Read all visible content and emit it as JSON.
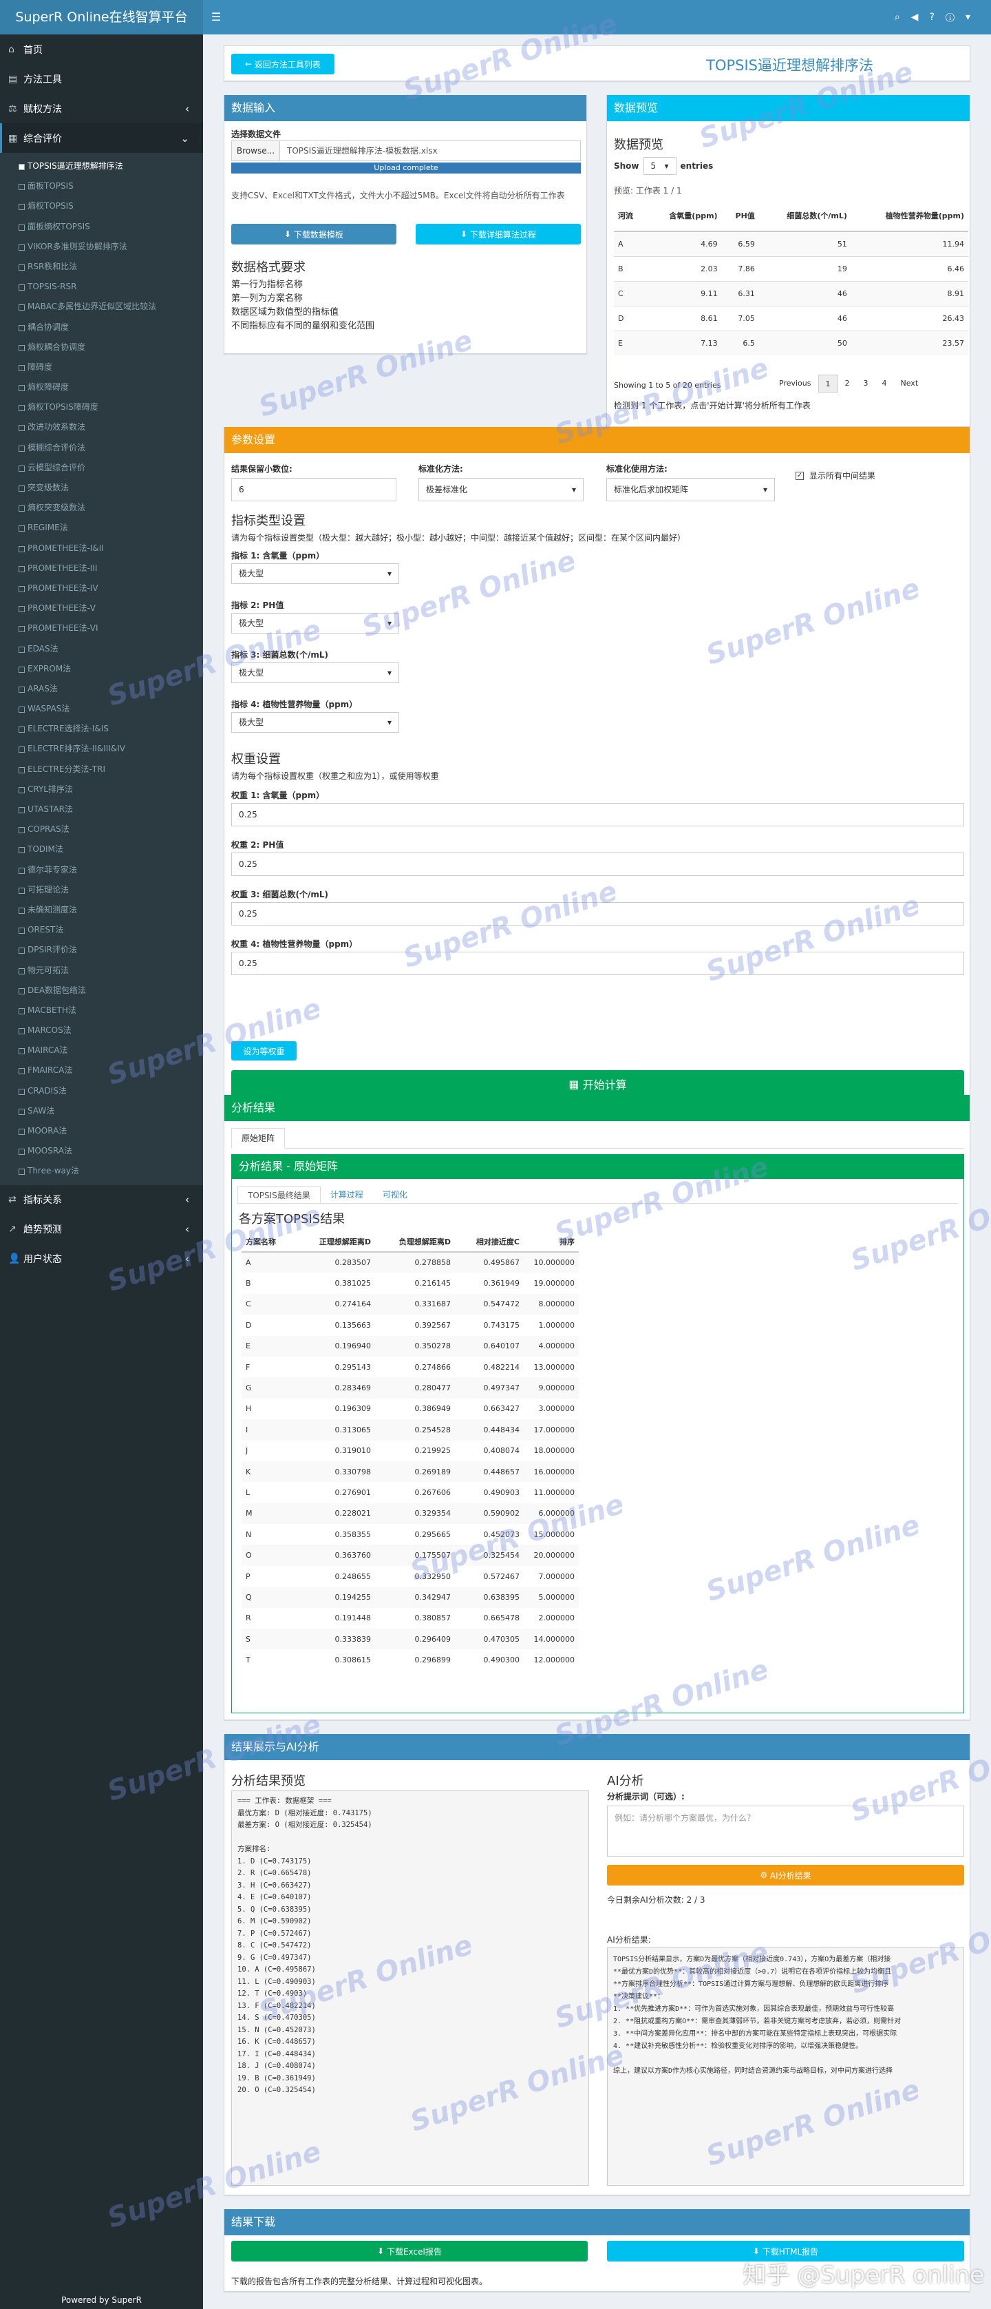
{
  "app": {
    "brand": "SuperR Online在线智算平台",
    "footer": "Powered by SuperR",
    "watermark": "SuperR Online",
    "corner_watermark": "知乎 @SuperR online"
  },
  "sidebar": {
    "top": [
      {
        "label": "首页",
        "icon": "home-icon"
      },
      {
        "label": "方法工具",
        "icon": "tools-icon"
      },
      {
        "label": "赋权方法",
        "icon": "balance-icon"
      },
      {
        "label": "综合评价",
        "icon": "chart-icon"
      }
    ],
    "items": [
      "TOPSIS逼近理想解排序法",
      "面板TOPSIS",
      "熵权TOPSIS",
      "面板熵权TOPSIS",
      "VIKOR多准则妥协解排序法",
      "RSR秩和比法",
      "TOPSIS-RSR",
      "MABAC多属性边界近似区域比较法",
      "耦合协调度",
      "熵权耦合协调度",
      "障碍度",
      "熵权障碍度",
      "熵权TOPSIS障碍度",
      "改进功效系数法",
      "模糊综合评价法",
      "云模型综合评价",
      "突变级数法",
      "熵权突变级数法",
      "REGIME法",
      "PROMETHEE法-I&II",
      "PROMETHEE法-III",
      "PROMETHEE法-IV",
      "PROMETHEE法-V",
      "PROMETHEE法-VI",
      "EDAS法",
      "EXPROM法",
      "ARAS法",
      "WASPAS法",
      "ELECTRE选择法-I&IS",
      "ELECTRE排序法-II&III&IV",
      "ELECTRE分类法-TRI",
      "CRYL排序法",
      "UTASTAR法",
      "COPRAS法",
      "TODIM法",
      "德尔菲专家法",
      "可拓理论法",
      "未确知测度法",
      "OREST法",
      "DPSIR评价法",
      "物元可拓法",
      "DEA数据包络法",
      "MACBETH法",
      "MARCOS法",
      "MAIRCA法",
      "FMAIRCA法",
      "CRADIS法",
      "SAW法",
      "MOORA法",
      "MOOSRA法",
      "Three-way法"
    ],
    "bottom": [
      {
        "label": "指标关系",
        "icon": "relation-icon"
      },
      {
        "label": "趋势预测",
        "icon": "trend-icon"
      },
      {
        "label": "用户状态",
        "icon": "user-icon"
      }
    ]
  },
  "header": {
    "back_button": "返回方法工具列表",
    "title": "TOPSIS逼近理想解排序法"
  },
  "input_box": {
    "title": "数据输入",
    "select_label": "选择数据文件",
    "browse": "Browse...",
    "file_name": "TOPSIS逼近理想解排序法-模板数据.xlsx",
    "upload_status": "Upload complete",
    "help": "支持CSV、Excel和TXT文件格式，文件大小不超过5MB。Excel文件将自动分析所有工作表",
    "download_template": "下载数据模板",
    "download_detail": "下载详细算法过程",
    "format_title": "数据格式要求",
    "format_lines": [
      "第一行为指标名称",
      "第一列为方案名称",
      "数据区域为数值型的指标值",
      "不同指标应有不同的量纲和变化范围"
    ]
  },
  "preview_box": {
    "title": "数据预览",
    "heading": "数据预览",
    "show": "Show",
    "entries_value": "5",
    "entries": "entries",
    "sheet": "预览: 工作表 1 / 1",
    "columns": [
      "河流",
      "含氧量(ppm)",
      "PH值",
      "细菌总数(个/mL)",
      "植物性营养物量(ppm)"
    ],
    "rows": [
      [
        "A",
        "4.69",
        "6.59",
        "51",
        "11.94"
      ],
      [
        "B",
        "2.03",
        "7.86",
        "19",
        "6.46"
      ],
      [
        "C",
        "9.11",
        "6.31",
        "46",
        "8.91"
      ],
      [
        "D",
        "8.61",
        "7.05",
        "46",
        "26.43"
      ],
      [
        "E",
        "7.13",
        "6.5",
        "50",
        "23.57"
      ]
    ],
    "info": "Showing 1 to 5 of 20 entries",
    "pager": [
      "Previous",
      "1",
      "2",
      "3",
      "4",
      "Next"
    ],
    "note": "检测到 1 个工作表，点击'开始计算'将分析所有工作表"
  },
  "params_box": {
    "title": "参数设置",
    "decimals_label": "结果保留小数位:",
    "decimals_value": "6",
    "norm_label": "标准化方法:",
    "norm_value": "极差标准化",
    "method_label": "标准化使用方法:",
    "method_value": "标准化后求加权矩阵",
    "show_mid": "显示所有中间结果",
    "type_title": "指标类型设置",
    "type_hint": "请为每个指标设置类型（极大型：越大越好；极小型：越小越好；中间型：越接近某个值越好；区间型：在某个区间内最好）",
    "types": [
      {
        "label": "指标 1: 含氧量（ppm）",
        "value": "极大型"
      },
      {
        "label": "指标 2: PH值",
        "value": "极大型"
      },
      {
        "label": "指标 3: 细菌总数(个/mL)",
        "value": "极大型"
      },
      {
        "label": "指标 4: 植物性营养物量（ppm）",
        "value": "极大型"
      }
    ],
    "weight_title": "权重设置",
    "weight_hint": "请为每个指标设置权重（权重之和应为1），或使用等权重",
    "weights": [
      {
        "label": "权重 1: 含氧量（ppm）",
        "value": "0.25"
      },
      {
        "label": "权重 2: PH值",
        "value": "0.25"
      },
      {
        "label": "权重 3: 细菌总数(个/mL)",
        "value": "0.25"
      },
      {
        "label": "权重 4: 植物性营养物量（ppm）",
        "value": "0.25"
      }
    ],
    "equal_button": "设为等权重",
    "start_button": "开始计算"
  },
  "results_box": {
    "title": "分析结果",
    "tab": "原始矩阵",
    "subtitle": "分析结果 - 原始矩阵",
    "subtabs": [
      "TOPSIS最终结果",
      "计算过程",
      "可视化"
    ],
    "table_title": "各方案TOPSIS结果",
    "columns": [
      "方案名称",
      "正理想解距离D",
      "负理想解距离D",
      "相对接近度C",
      "排序"
    ],
    "rows": [
      [
        "A",
        "0.283507",
        "0.278858",
        "0.495867",
        "10.000000"
      ],
      [
        "B",
        "0.381025",
        "0.216145",
        "0.361949",
        "19.000000"
      ],
      [
        "C",
        "0.274164",
        "0.331687",
        "0.547472",
        "8.000000"
      ],
      [
        "D",
        "0.135663",
        "0.392567",
        "0.743175",
        "1.000000"
      ],
      [
        "E",
        "0.196940",
        "0.350278",
        "0.640107",
        "4.000000"
      ],
      [
        "F",
        "0.295143",
        "0.274866",
        "0.482214",
        "13.000000"
      ],
      [
        "G",
        "0.283469",
        "0.280477",
        "0.497347",
        "9.000000"
      ],
      [
        "H",
        "0.196309",
        "0.386949",
        "0.663427",
        "3.000000"
      ],
      [
        "I",
        "0.313065",
        "0.254528",
        "0.448434",
        "17.000000"
      ],
      [
        "J",
        "0.319010",
        "0.219925",
        "0.408074",
        "18.000000"
      ],
      [
        "K",
        "0.330798",
        "0.269189",
        "0.448657",
        "16.000000"
      ],
      [
        "L",
        "0.276901",
        "0.267606",
        "0.490903",
        "11.000000"
      ],
      [
        "M",
        "0.228021",
        "0.329354",
        "0.590902",
        "6.000000"
      ],
      [
        "N",
        "0.358355",
        "0.295665",
        "0.452073",
        "15.000000"
      ],
      [
        "O",
        "0.363760",
        "0.175507",
        "0.325454",
        "20.000000"
      ],
      [
        "P",
        "0.248655",
        "0.332950",
        "0.572467",
        "7.000000"
      ],
      [
        "Q",
        "0.194255",
        "0.342947",
        "0.638395",
        "5.000000"
      ],
      [
        "R",
        "0.191448",
        "0.380857",
        "0.665478",
        "2.000000"
      ],
      [
        "S",
        "0.333839",
        "0.296409",
        "0.470305",
        "14.000000"
      ],
      [
        "T",
        "0.308615",
        "0.296899",
        "0.490300",
        "12.000000"
      ]
    ]
  },
  "ai_box": {
    "title": "结果展示与AI分析",
    "preview_title": "分析结果预览",
    "preview_lines": [
      "=== 工作表: 数据框架 ===",
      "最优方案: D (相对接近度: 0.743175)",
      "最差方案: O (相对接近度: 0.325454)",
      "",
      "方案排名:",
      "1. D (C=0.743175)",
      "2. R (C=0.665478)",
      "3. H (C=0.663427)",
      "4. E (C=0.640107)",
      "5. Q (C=0.638395)",
      "6. M (C=0.590902)",
      "7. P (C=0.572467)",
      "8. C (C=0.547472)",
      "9. G (C=0.497347)",
      "10. A (C=0.495867)",
      "11. L (C=0.490903)",
      "12. T (C=0.4903)",
      "13. F (C=0.482214)",
      "14. S (C=0.470305)",
      "15. N (C=0.452073)",
      "16. K (C=0.448657)",
      "17. I (C=0.448434)",
      "18. J (C=0.408074)",
      "19. B (C=0.361949)",
      "20. O (C=0.325454)"
    ],
    "ai_title": "AI分析",
    "prompt_label": "分析提示词（可选）:",
    "prompt_placeholder": "例如：请分析哪个方案最优，为什么？",
    "ai_button": "AI分析结果",
    "remaining": "今日剩余AI分析次数: 2 / 3",
    "result_label": "AI分析结果:",
    "ai_lines": [
      "TOPSIS分析结果显示，方案D为最优方案（相对接近度0.743），方案O为最差方案（相对接",
      "**最优方案D的优势**：其较高的相对接近度（>0.7）说明它在各项评价指标上较为均衡且",
      "**方案排序合理性分析**：TOPSIS通过计算方案与理想解、负理想解的欧氏距离进行排序",
      "**决策建议**：",
      "1. **优先推进方案D**：可作为首选实施对象，因其综合表现最佳，预期效益与可行性较高",
      "2. **阻抗或重构方案O**：需审查其薄弱环节，若非关键方案可考虑放弃，若必须，则需针对",
      "3. **中间方案差异化应用**：排名中部的方案可能在某些特定指标上表现突出，可根据实际",
      "4. **建议补充敏感性分析**：检验权重变化对排序的影响，以增强决策稳健性。",
      "",
      "综上，建议以方案D作为核心实施路径，同时结合资源约束与战略目标，对中间方案进行选择"
    ]
  },
  "download_box": {
    "title": "结果下载",
    "excel": "下载Excel报告",
    "html": "下载HTML报告",
    "note": "下载的报告包含所有工作表的完整分析结果、计算过程和可视化图表。"
  }
}
